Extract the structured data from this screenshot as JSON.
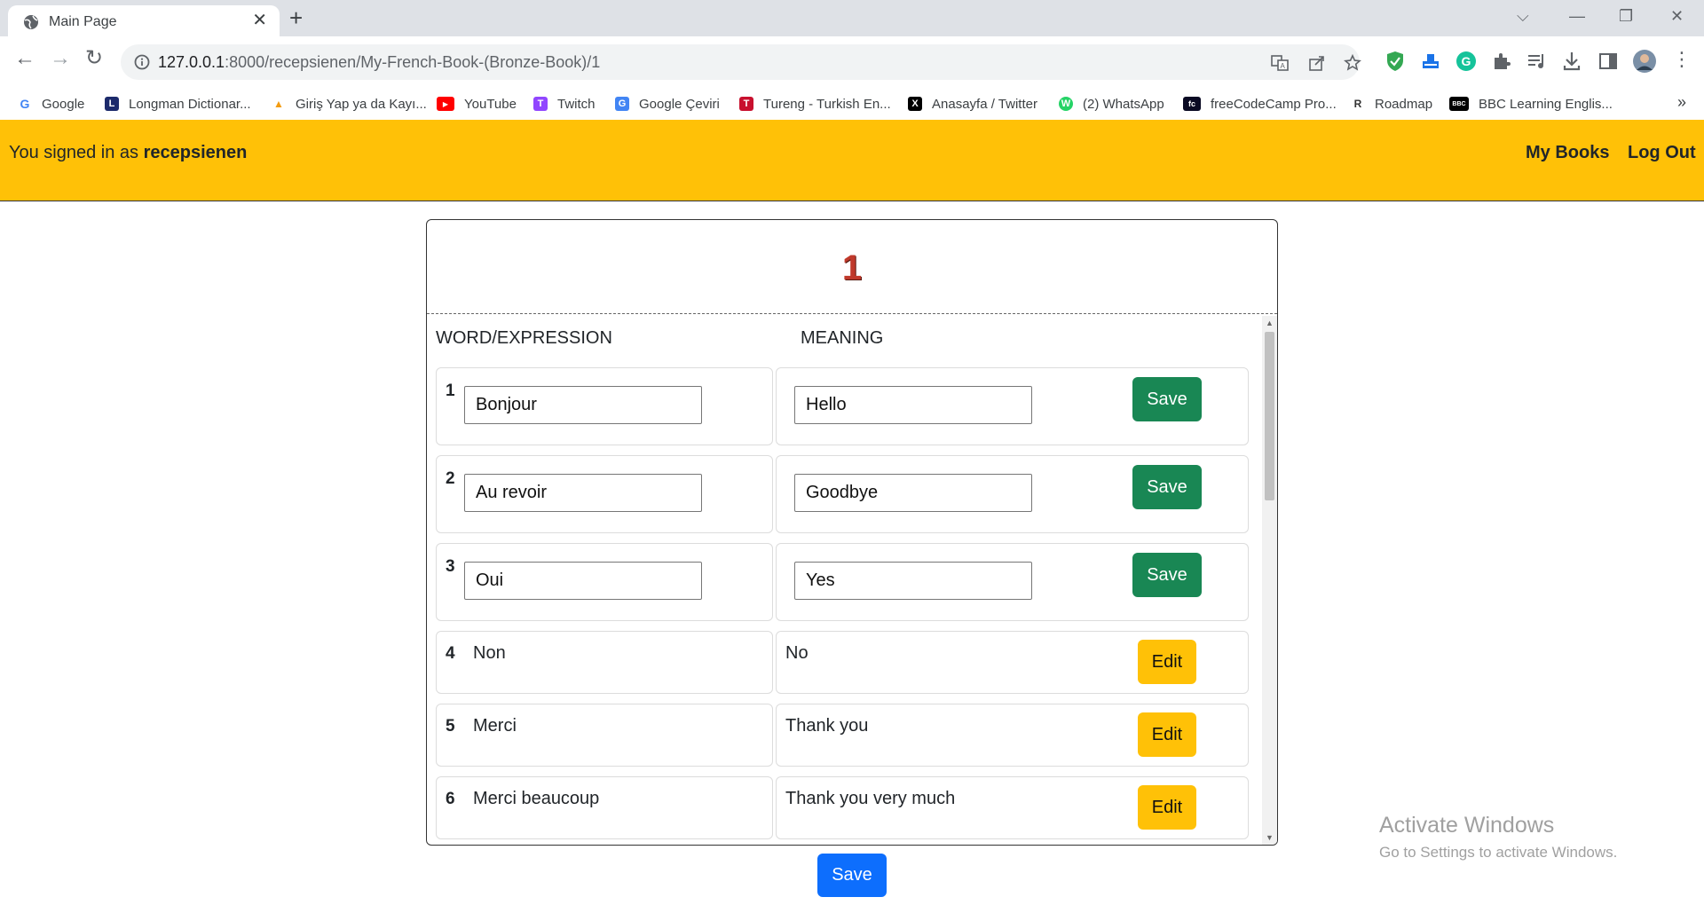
{
  "browser": {
    "tab_title": "Main Page",
    "tab_close": "✕",
    "new_tab": "+",
    "url_host": "127.0.0.1",
    "url_rest": ":8000/recepsienen/My-French-Book-(Bronze-Book)/1",
    "window_controls": {
      "tablist": "⌵",
      "minimize": "—",
      "restore": "❐",
      "close": "✕"
    },
    "nav": {
      "back": "←",
      "forward": "→",
      "reload": "↻"
    },
    "bookmarks": [
      {
        "label": "Google",
        "icon": "google-icon",
        "color": "#4285f4",
        "glyph": "G"
      },
      {
        "label": "Longman Dictionar...",
        "icon": "longman-icon",
        "color": "#1c2a6b",
        "glyph": "L"
      },
      {
        "label": "Giriş Yap ya da Kayı...",
        "icon": "rocket-icon",
        "color": "#f39c12",
        "glyph": "▲"
      },
      {
        "label": "YouTube",
        "icon": "youtube-icon",
        "color": "#ff0000",
        "glyph": "▶"
      },
      {
        "label": "Twitch",
        "icon": "twitch-icon",
        "color": "#9146ff",
        "glyph": "T"
      },
      {
        "label": "Google Çeviri",
        "icon": "google-translate-icon",
        "color": "#4285f4",
        "glyph": "G"
      },
      {
        "label": "Tureng - Turkish En...",
        "icon": "tureng-icon",
        "color": "#c8102e",
        "glyph": "T"
      },
      {
        "label": "Anasayfa / Twitter",
        "icon": "x-twitter-icon",
        "color": "#000000",
        "glyph": "X"
      },
      {
        "label": "(2) WhatsApp",
        "icon": "whatsapp-icon",
        "color": "#25d366",
        "glyph": "W"
      },
      {
        "label": "freeCodeCamp Pro...",
        "icon": "freecodecamp-icon",
        "color": "#0a0a23",
        "glyph": "fc"
      },
      {
        "label": "Roadmap",
        "icon": "roadmap-icon",
        "color": "#333333",
        "glyph": "R"
      },
      {
        "label": "BBC Learning Englis...",
        "icon": "bbc-icon",
        "color": "#000000",
        "glyph": "BBC"
      }
    ],
    "bookmarks_more": "»"
  },
  "header": {
    "signed_prefix": "You signed in as",
    "username": "recepsienen",
    "my_books": "My Books",
    "log_out": "Log Out",
    "bg_color": "#ffc107"
  },
  "page": {
    "page_number": "1",
    "col_word": "WORD/EXPRESSION",
    "col_meaning": "MEANING",
    "editing_rows": [
      {
        "num": "1",
        "word": "Bonjour",
        "meaning": "Hello",
        "button": "Save"
      },
      {
        "num": "2",
        "word": "Au revoir",
        "meaning": "Goodbye",
        "button": "Save"
      },
      {
        "num": "3",
        "word": "Oui",
        "meaning": "Yes",
        "button": "Save"
      }
    ],
    "static_rows": [
      {
        "num": "4",
        "word": "Non",
        "meaning": "No",
        "button": "Edit"
      },
      {
        "num": "5",
        "word": "Merci",
        "meaning": "Thank you",
        "button": "Edit"
      },
      {
        "num": "6",
        "word": "Merci beaucoup",
        "meaning": "Thank you very much",
        "button": "Edit"
      }
    ],
    "save_all": "Save"
  },
  "os_watermark": {
    "line1": "Activate Windows",
    "line2": "Go to Settings to activate Windows."
  }
}
